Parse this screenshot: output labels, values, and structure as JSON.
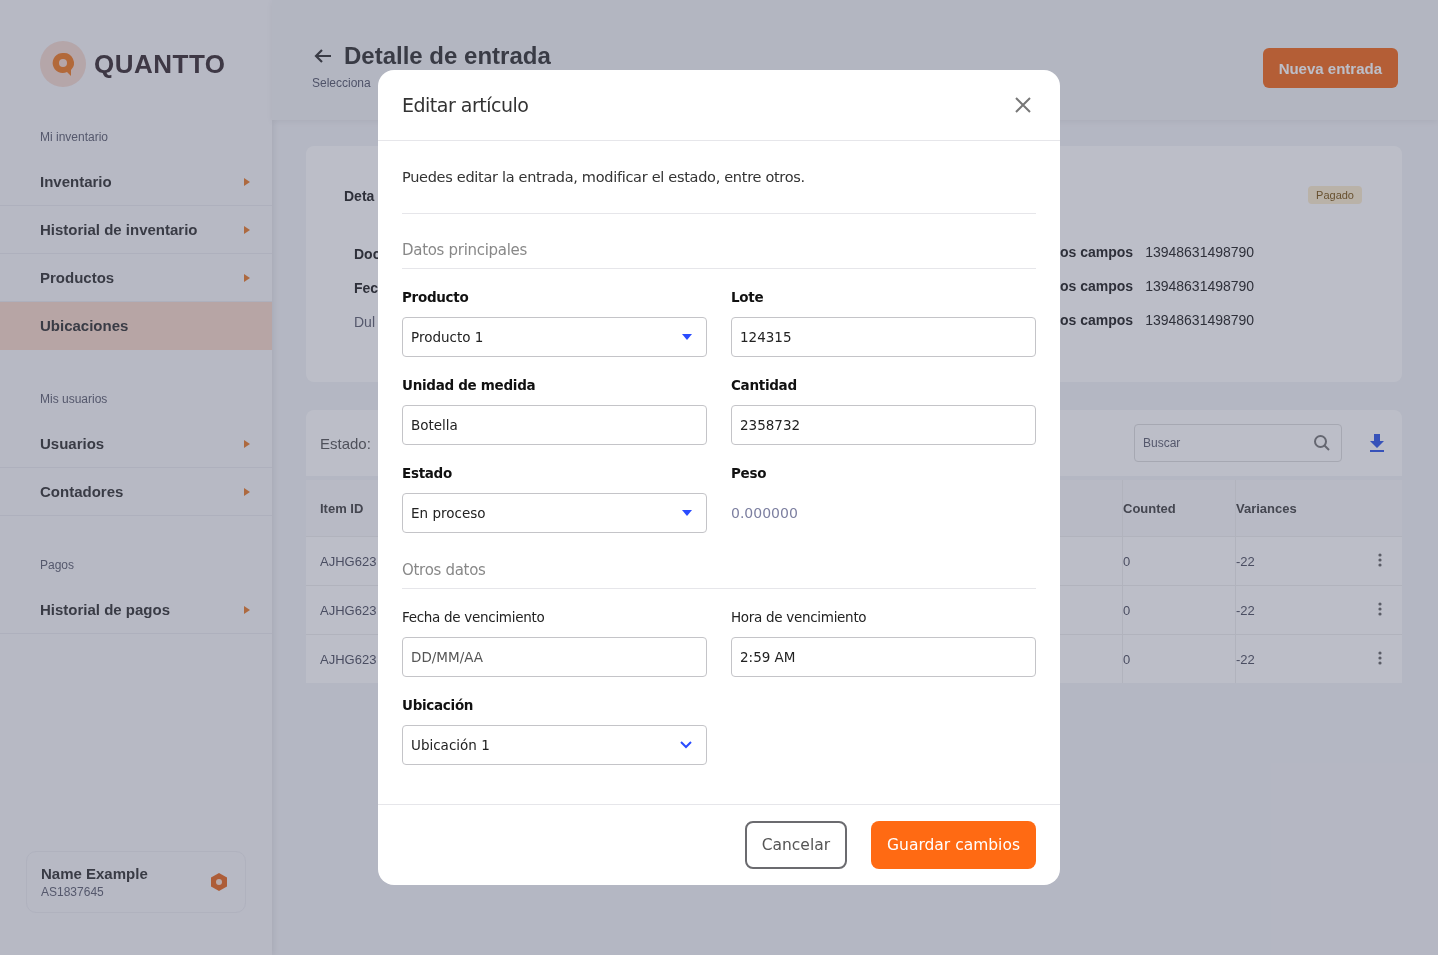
{
  "sidebar": {
    "logo": "QUANTTO",
    "sections": [
      {
        "title": "Mi inventario",
        "items": [
          {
            "label": "Inventario",
            "selected": false,
            "arrow": true
          },
          {
            "label": "Historial de inventario",
            "selected": false,
            "arrow": true
          },
          {
            "label": "Productos",
            "selected": false,
            "arrow": true
          },
          {
            "label": "Ubicaciones",
            "selected": true,
            "arrow": false
          }
        ]
      },
      {
        "title": "Mis usuarios",
        "items": [
          {
            "label": "Usuarios",
            "selected": false,
            "arrow": true
          },
          {
            "label": "Contadores",
            "selected": false,
            "arrow": true
          }
        ]
      },
      {
        "title": "Pagos",
        "items": [
          {
            "label": "Historial de pagos",
            "selected": false,
            "arrow": true
          }
        ]
      }
    ],
    "user": {
      "name": "Name Example",
      "id": "AS1837645"
    }
  },
  "header": {
    "title": "Detalle de entrada",
    "subtitle": "Selecciona",
    "button": "Nueva entrada"
  },
  "summary_card": {
    "heading": "Deta",
    "badge": "Pagado",
    "rows": [
      {
        "label": "Doc",
        "field": "os campos",
        "value": "13948631498790",
        "muted": false
      },
      {
        "label": "Fec",
        "field": "os campos",
        "value": "13948631498790",
        "muted": false
      },
      {
        "label": "Dul",
        "field": "os campos",
        "value": "13948631498790",
        "muted": true
      }
    ]
  },
  "table": {
    "filter_label": "Estado:",
    "search_placeholder": "Buscar",
    "columns_left": [
      "Item ID"
    ],
    "columns_right": [
      "Counted",
      "Variances"
    ],
    "rows": [
      {
        "item": "AJHG623",
        "counted": "0",
        "variance": "-22"
      },
      {
        "item": "AJHG623",
        "counted": "0",
        "variance": "-22"
      },
      {
        "item": "AJHG623",
        "counted": "0",
        "variance": "-22"
      }
    ]
  },
  "dialog": {
    "title": "Editar artículo",
    "description": "Puedes editar la entrada, modificar el estado, entre otros.",
    "sections": [
      {
        "title": "Datos principales",
        "fields": [
          {
            "label": "Producto",
            "bold": true,
            "kind": "select",
            "value": "Producto 1"
          },
          {
            "label": "Lote",
            "bold": true,
            "kind": "text",
            "value": "124315"
          },
          {
            "label": "Unidad de medida",
            "bold": true,
            "kind": "text",
            "value": "Botella"
          },
          {
            "label": "Cantidad",
            "bold": true,
            "kind": "text",
            "value": "2358732"
          },
          {
            "label": "Estado",
            "bold": true,
            "kind": "select",
            "value": "En proceso"
          },
          {
            "label": "Peso",
            "bold": true,
            "kind": "readonly",
            "value": "0.000000"
          }
        ]
      },
      {
        "title": "Otros datos",
        "fields": [
          {
            "label": "Fecha de vencimiento",
            "bold": false,
            "kind": "text",
            "placeholder": "DD/MM/AA"
          },
          {
            "label": "Hora de vencimiento",
            "bold": false,
            "kind": "text",
            "value": "2:59 AM"
          },
          {
            "label": "Ubicación",
            "bold": true,
            "kind": "dropdown",
            "value": "Ubicación 1"
          }
        ]
      }
    ],
    "buttons": [
      {
        "label": "Cancelar",
        "kind": "secondary"
      },
      {
        "label": "Guardar cambios",
        "kind": "primary"
      }
    ]
  }
}
